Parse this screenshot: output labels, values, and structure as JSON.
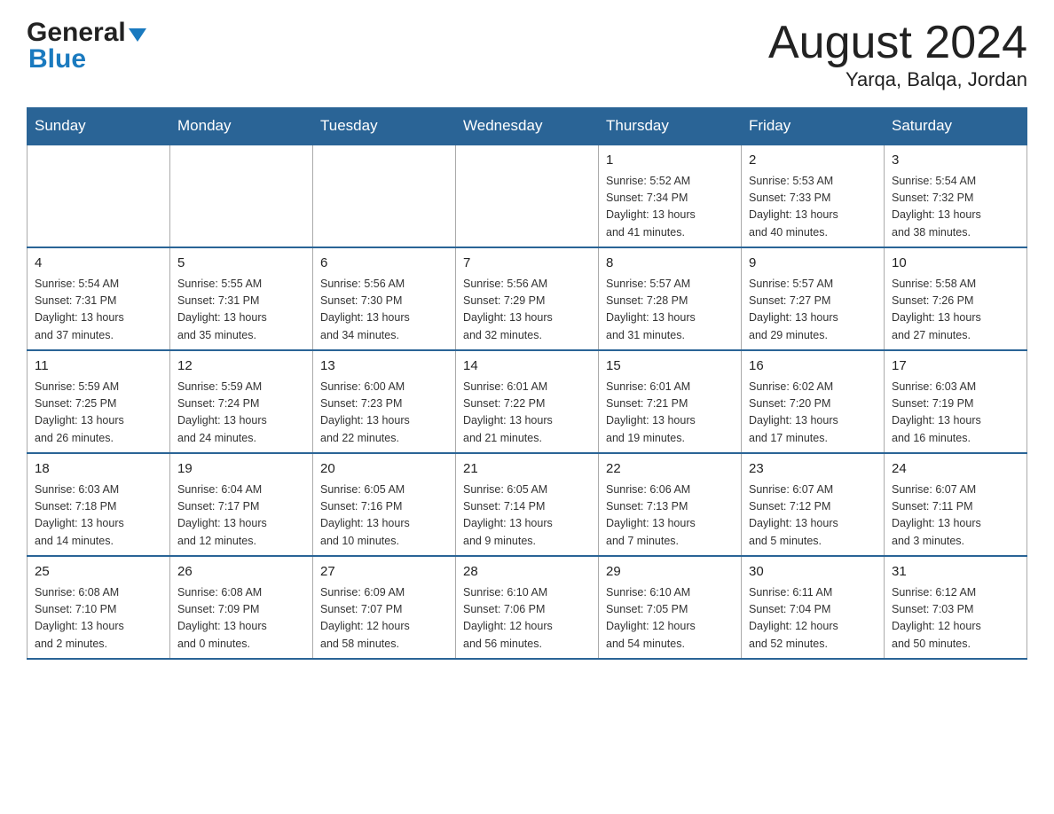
{
  "header": {
    "logo_general": "General",
    "logo_blue": "Blue",
    "title": "August 2024",
    "subtitle": "Yarqa, Balqa, Jordan"
  },
  "weekdays": [
    "Sunday",
    "Monday",
    "Tuesday",
    "Wednesday",
    "Thursday",
    "Friday",
    "Saturday"
  ],
  "weeks": [
    [
      {
        "day": "",
        "info": ""
      },
      {
        "day": "",
        "info": ""
      },
      {
        "day": "",
        "info": ""
      },
      {
        "day": "",
        "info": ""
      },
      {
        "day": "1",
        "info": "Sunrise: 5:52 AM\nSunset: 7:34 PM\nDaylight: 13 hours\nand 41 minutes."
      },
      {
        "day": "2",
        "info": "Sunrise: 5:53 AM\nSunset: 7:33 PM\nDaylight: 13 hours\nand 40 minutes."
      },
      {
        "day": "3",
        "info": "Sunrise: 5:54 AM\nSunset: 7:32 PM\nDaylight: 13 hours\nand 38 minutes."
      }
    ],
    [
      {
        "day": "4",
        "info": "Sunrise: 5:54 AM\nSunset: 7:31 PM\nDaylight: 13 hours\nand 37 minutes."
      },
      {
        "day": "5",
        "info": "Sunrise: 5:55 AM\nSunset: 7:31 PM\nDaylight: 13 hours\nand 35 minutes."
      },
      {
        "day": "6",
        "info": "Sunrise: 5:56 AM\nSunset: 7:30 PM\nDaylight: 13 hours\nand 34 minutes."
      },
      {
        "day": "7",
        "info": "Sunrise: 5:56 AM\nSunset: 7:29 PM\nDaylight: 13 hours\nand 32 minutes."
      },
      {
        "day": "8",
        "info": "Sunrise: 5:57 AM\nSunset: 7:28 PM\nDaylight: 13 hours\nand 31 minutes."
      },
      {
        "day": "9",
        "info": "Sunrise: 5:57 AM\nSunset: 7:27 PM\nDaylight: 13 hours\nand 29 minutes."
      },
      {
        "day": "10",
        "info": "Sunrise: 5:58 AM\nSunset: 7:26 PM\nDaylight: 13 hours\nand 27 minutes."
      }
    ],
    [
      {
        "day": "11",
        "info": "Sunrise: 5:59 AM\nSunset: 7:25 PM\nDaylight: 13 hours\nand 26 minutes."
      },
      {
        "day": "12",
        "info": "Sunrise: 5:59 AM\nSunset: 7:24 PM\nDaylight: 13 hours\nand 24 minutes."
      },
      {
        "day": "13",
        "info": "Sunrise: 6:00 AM\nSunset: 7:23 PM\nDaylight: 13 hours\nand 22 minutes."
      },
      {
        "day": "14",
        "info": "Sunrise: 6:01 AM\nSunset: 7:22 PM\nDaylight: 13 hours\nand 21 minutes."
      },
      {
        "day": "15",
        "info": "Sunrise: 6:01 AM\nSunset: 7:21 PM\nDaylight: 13 hours\nand 19 minutes."
      },
      {
        "day": "16",
        "info": "Sunrise: 6:02 AM\nSunset: 7:20 PM\nDaylight: 13 hours\nand 17 minutes."
      },
      {
        "day": "17",
        "info": "Sunrise: 6:03 AM\nSunset: 7:19 PM\nDaylight: 13 hours\nand 16 minutes."
      }
    ],
    [
      {
        "day": "18",
        "info": "Sunrise: 6:03 AM\nSunset: 7:18 PM\nDaylight: 13 hours\nand 14 minutes."
      },
      {
        "day": "19",
        "info": "Sunrise: 6:04 AM\nSunset: 7:17 PM\nDaylight: 13 hours\nand 12 minutes."
      },
      {
        "day": "20",
        "info": "Sunrise: 6:05 AM\nSunset: 7:16 PM\nDaylight: 13 hours\nand 10 minutes."
      },
      {
        "day": "21",
        "info": "Sunrise: 6:05 AM\nSunset: 7:14 PM\nDaylight: 13 hours\nand 9 minutes."
      },
      {
        "day": "22",
        "info": "Sunrise: 6:06 AM\nSunset: 7:13 PM\nDaylight: 13 hours\nand 7 minutes."
      },
      {
        "day": "23",
        "info": "Sunrise: 6:07 AM\nSunset: 7:12 PM\nDaylight: 13 hours\nand 5 minutes."
      },
      {
        "day": "24",
        "info": "Sunrise: 6:07 AM\nSunset: 7:11 PM\nDaylight: 13 hours\nand 3 minutes."
      }
    ],
    [
      {
        "day": "25",
        "info": "Sunrise: 6:08 AM\nSunset: 7:10 PM\nDaylight: 13 hours\nand 2 minutes."
      },
      {
        "day": "26",
        "info": "Sunrise: 6:08 AM\nSunset: 7:09 PM\nDaylight: 13 hours\nand 0 minutes."
      },
      {
        "day": "27",
        "info": "Sunrise: 6:09 AM\nSunset: 7:07 PM\nDaylight: 12 hours\nand 58 minutes."
      },
      {
        "day": "28",
        "info": "Sunrise: 6:10 AM\nSunset: 7:06 PM\nDaylight: 12 hours\nand 56 minutes."
      },
      {
        "day": "29",
        "info": "Sunrise: 6:10 AM\nSunset: 7:05 PM\nDaylight: 12 hours\nand 54 minutes."
      },
      {
        "day": "30",
        "info": "Sunrise: 6:11 AM\nSunset: 7:04 PM\nDaylight: 12 hours\nand 52 minutes."
      },
      {
        "day": "31",
        "info": "Sunrise: 6:12 AM\nSunset: 7:03 PM\nDaylight: 12 hours\nand 50 minutes."
      }
    ]
  ]
}
